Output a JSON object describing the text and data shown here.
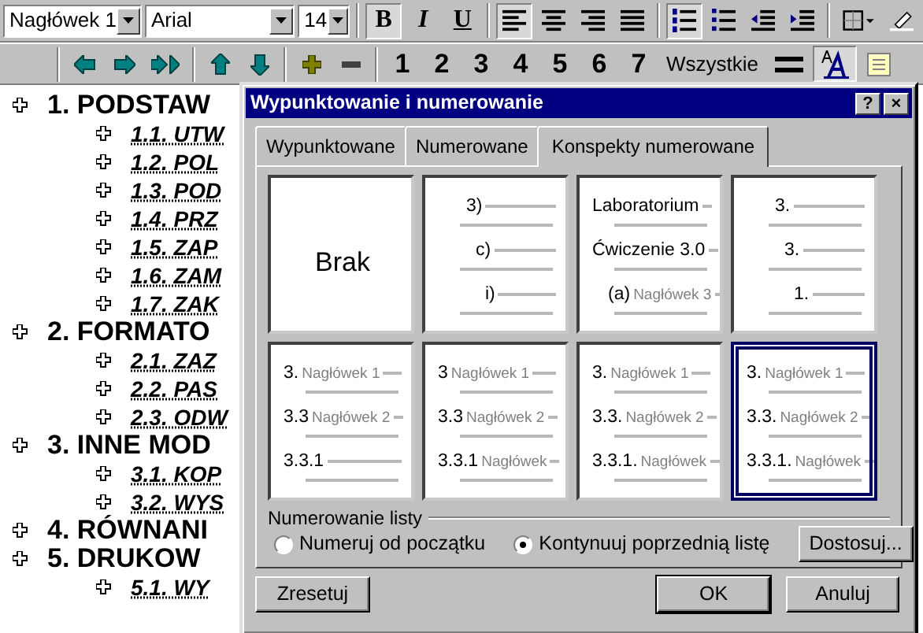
{
  "toolbar_formatting": {
    "style": "Nagłówek 1",
    "font": "Arial",
    "size": "14",
    "buttons": [
      {
        "kind": "text",
        "label": "B",
        "pressed": true
      },
      {
        "kind": "text",
        "label": "I",
        "pressed": false
      },
      {
        "kind": "text",
        "label": "U",
        "pressed": false
      },
      {
        "kind": "icon",
        "pressed": true
      },
      {
        "kind": "icon",
        "pressed": false
      },
      {
        "kind": "icon",
        "pressed": false
      },
      {
        "kind": "icon",
        "pressed": false
      },
      {
        "kind": "icon",
        "pressed": true
      },
      {
        "kind": "icon",
        "pressed": false
      },
      {
        "kind": "icon",
        "pressed": false
      },
      {
        "kind": "icon",
        "pressed": false
      },
      {
        "kind": "icon",
        "pressed": false
      },
      {
        "kind": "icon",
        "pressed": false
      }
    ]
  },
  "toolbar_outline": {
    "buttons": [
      {
        "kind": "icon",
        "pressed": false
      },
      {
        "kind": "icon",
        "pressed": false
      },
      {
        "kind": "icon",
        "pressed": false
      },
      {
        "kind": "icon",
        "pressed": false
      },
      {
        "kind": "icon",
        "pressed": false
      },
      {
        "kind": "icon",
        "pressed": false
      },
      {
        "kind": "icon",
        "pressed": false
      },
      {
        "kind": "text",
        "label": "1",
        "pressed": false
      },
      {
        "kind": "text",
        "label": "2",
        "pressed": false
      },
      {
        "kind": "text",
        "label": "3",
        "pressed": false
      },
      {
        "kind": "text",
        "label": "4",
        "pressed": false
      },
      {
        "kind": "text",
        "label": "5",
        "pressed": false
      },
      {
        "kind": "text",
        "label": "6",
        "pressed": false
      },
      {
        "kind": "text",
        "label": "7",
        "pressed": false
      },
      {
        "kind": "text",
        "label": "Wszystkie",
        "pressed": false
      },
      {
        "kind": "icon",
        "pressed": false
      },
      {
        "kind": "icon",
        "pressed": true
      },
      {
        "kind": "icon",
        "pressed": false
      }
    ]
  },
  "outline": [
    {
      "text": "1. PODSTAW",
      "children": [
        {
          "text": "1.1. UTW"
        },
        {
          "text": "1.2. POL"
        },
        {
          "text": "1.3. POD"
        },
        {
          "text": "1.4. PRZ"
        },
        {
          "text": "1.5. ZAP"
        },
        {
          "text": "1.6. ZAM"
        },
        {
          "text": "1.7. ZAK"
        }
      ]
    },
    {
      "text": "2. FORMATO",
      "children": [
        {
          "text": "2.1. ZAZ"
        },
        {
          "text": "2.2. PAS"
        },
        {
          "text": "2.3. ODW"
        }
      ]
    },
    {
      "text": "3. INNE MOD",
      "children": [
        {
          "text": "3.1. KOP"
        },
        {
          "text": "3.2. WYS"
        }
      ]
    },
    {
      "text": "4. RÓWNANI"
    },
    {
      "text": "5. DRUKOW",
      "children": [
        {
          "text": "5.1. WY"
        }
      ]
    }
  ],
  "dialog": {
    "title": "Wypunktowanie i numerowanie",
    "help": "?",
    "close": "×",
    "tabs": [
      {
        "label": "Wypunktowane",
        "selected": false
      },
      {
        "label": "Numerowane",
        "selected": false
      },
      {
        "label": "Konspekty numerowane",
        "selected": true
      }
    ],
    "tiles": [
      {
        "kind": "blank",
        "label": "Brak",
        "selected": false
      },
      {
        "kind": "stepped",
        "selected": false,
        "levels": [
          {
            "lead": "3)"
          },
          {
            "lead": "c)"
          },
          {
            "lead": "i)"
          }
        ]
      },
      {
        "kind": "flush",
        "selected": false,
        "levels": [
          {
            "lead": "Laboratorium"
          },
          {
            "lead": "Ćwiczenie 3.0"
          },
          {
            "lead": "(a)",
            "text": "Nagłówek 3"
          }
        ]
      },
      {
        "kind": "stepped",
        "selected": false,
        "levels": [
          {
            "lead": "3."
          },
          {
            "lead": "3."
          },
          {
            "lead": "1."
          }
        ]
      },
      {
        "kind": "flush",
        "selected": false,
        "levels": [
          {
            "lead": "3.",
            "text": "Nagłówek 1"
          },
          {
            "lead": "3.3",
            "text": "Nagłówek 2"
          },
          {
            "lead": "3.3.1"
          }
        ]
      },
      {
        "kind": "flush",
        "selected": false,
        "levels": [
          {
            "lead": "3",
            "text": "Nagłówek 1"
          },
          {
            "lead": "3.3",
            "text": "Nagłówek 2"
          },
          {
            "lead": "3.3.1",
            "text": "Nagłówek"
          }
        ]
      },
      {
        "kind": "flush",
        "selected": false,
        "levels": [
          {
            "lead": "3.",
            "text": "Nagłówek 1"
          },
          {
            "lead": "3.3.",
            "text": "Nagłówek 2"
          },
          {
            "lead": "3.3.1.",
            "text": "Nagłówek"
          }
        ]
      },
      {
        "kind": "flush",
        "selected": true,
        "levels": [
          {
            "lead": "3.",
            "text": "Nagłówek 1"
          },
          {
            "lead": "3.3.",
            "text": "Nagłówek 2"
          },
          {
            "lead": "3.3.1.",
            "text": "Nagłówek"
          }
        ]
      }
    ],
    "group_label": "Numerowanie listy",
    "radios": [
      {
        "label": "Numeruj od początku",
        "checked": false
      },
      {
        "label": "Kontynuuj poprzednią listę",
        "checked": true
      }
    ],
    "customize": "Dostosuj...",
    "reset": "Zresetuj",
    "ok": "OK",
    "cancel": "Anuluj"
  }
}
